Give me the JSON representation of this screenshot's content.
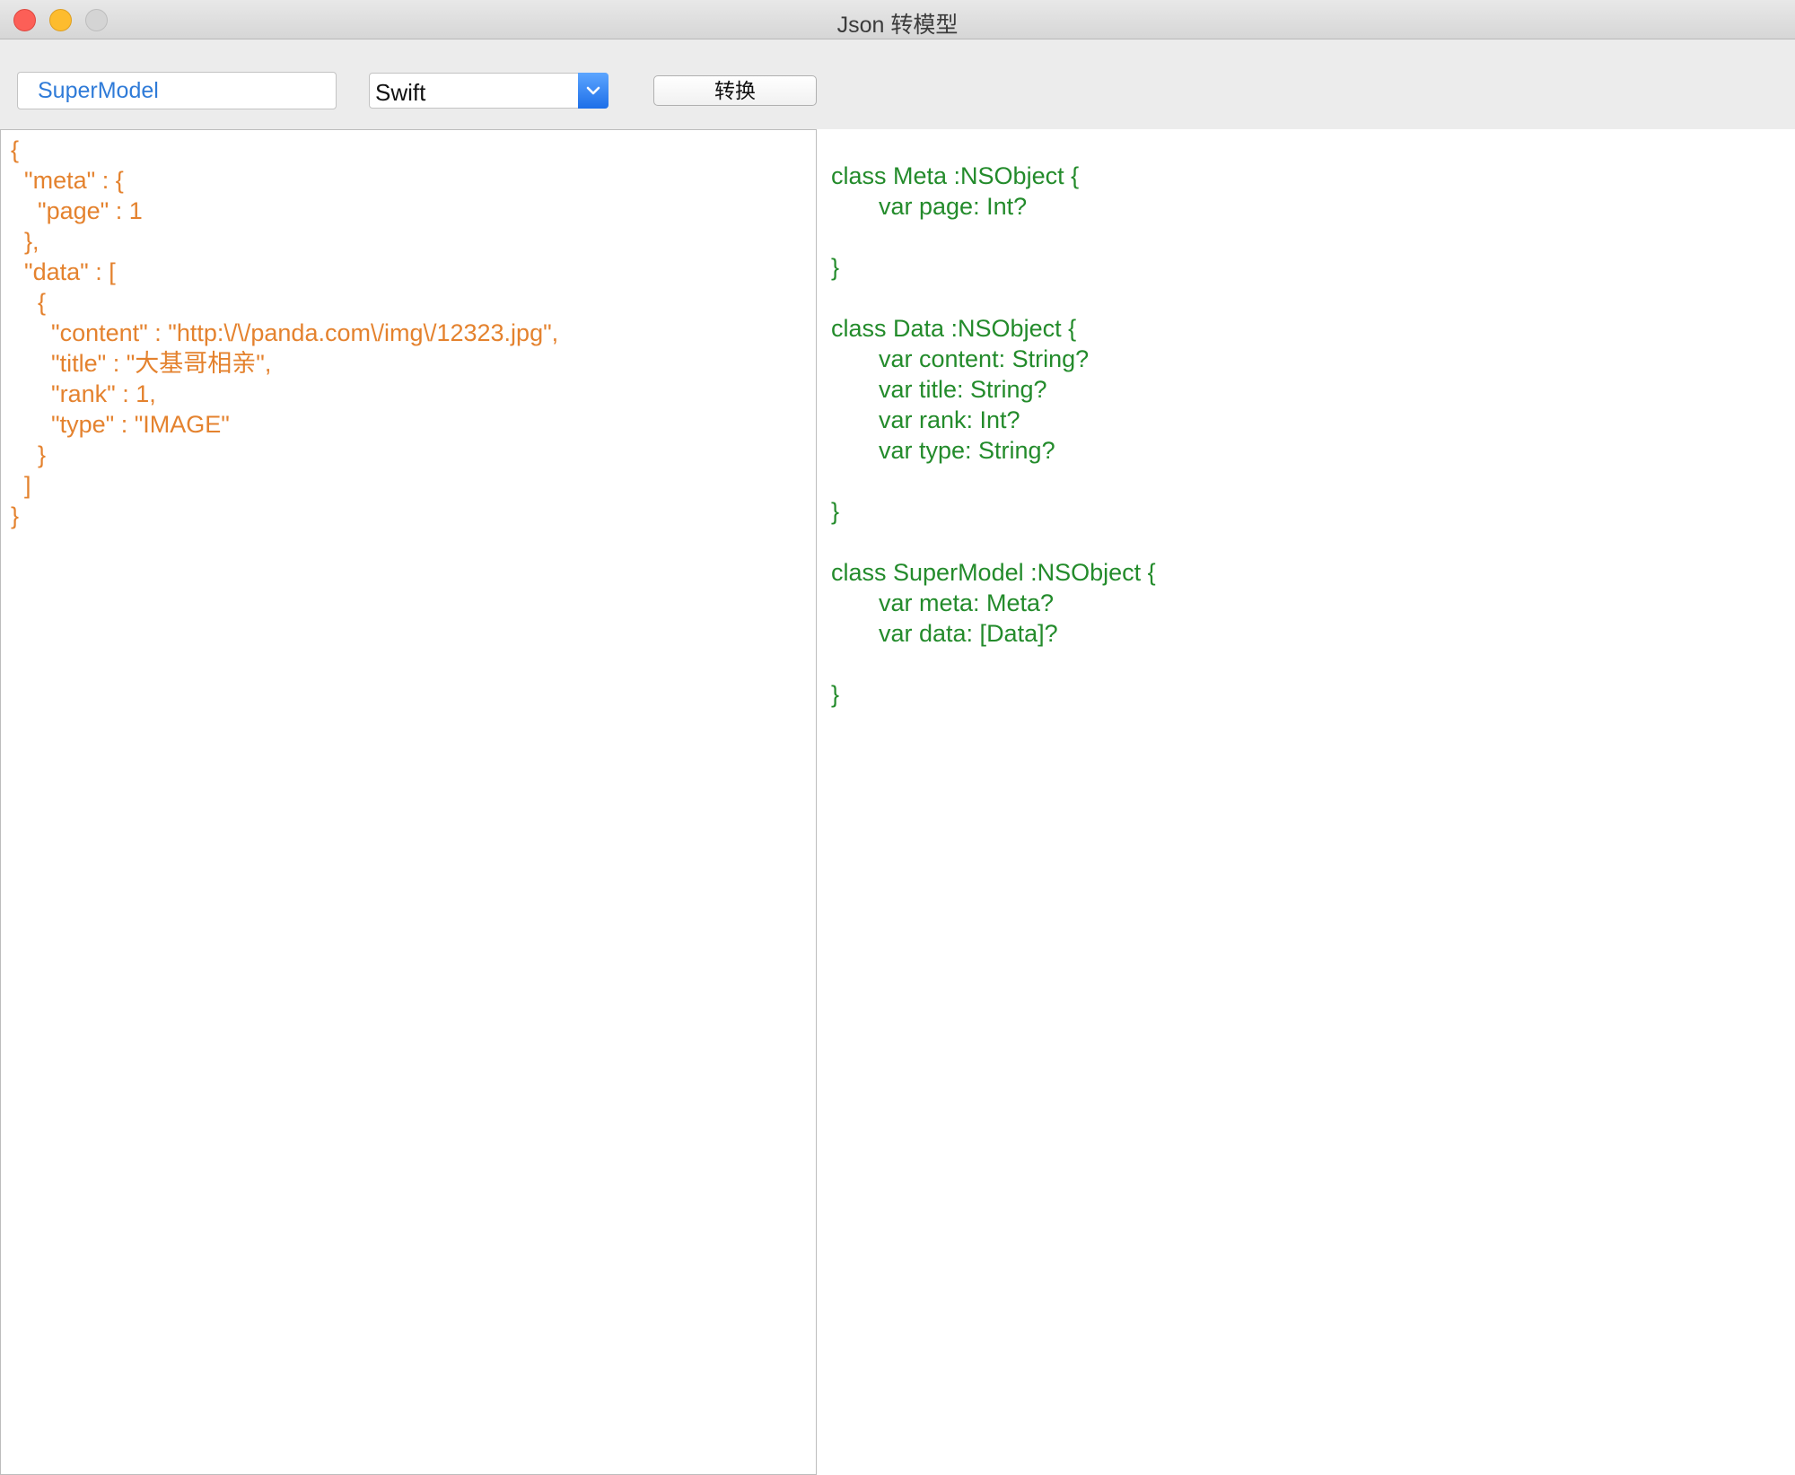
{
  "window": {
    "title": "Json 转模型"
  },
  "toolbar": {
    "class_name_value": "SuperModel",
    "language_selected": "Swift",
    "convert_label": "转换"
  },
  "json_input": {
    "lines": [
      "{",
      "  \"meta\" : {",
      "    \"page\" : 1",
      "  },",
      "  \"data\" : [",
      "    {",
      "      \"content\" : \"http:\\/\\/panda.com\\/img\\/12323.jpg\",",
      "      \"title\" : \"大基哥相亲\",",
      "      \"rank\" : 1,",
      "      \"type\" : \"IMAGE\"",
      "    }",
      "  ]",
      "}"
    ]
  },
  "code_output": {
    "lines": [
      "class Meta :NSObject {",
      "var page: Int?",
      "}",
      "class Data :NSObject {",
      "var content: String?",
      "var title: String?",
      "var rank: Int?",
      "var type: String?",
      "}",
      "class SuperModel :NSObject {",
      "var meta: Meta?",
      "var data: [Data]?",
      "}"
    ]
  },
  "colors": {
    "json_text": "#e4822e",
    "code_text": "#238b2b",
    "input_text": "#2f7bd8",
    "select_accent": "#2a7cf0"
  },
  "icons": {
    "close": "close-icon",
    "minimize": "minimize-icon",
    "zoom": "zoom-icon",
    "dropdown": "chevron-down-icon"
  }
}
